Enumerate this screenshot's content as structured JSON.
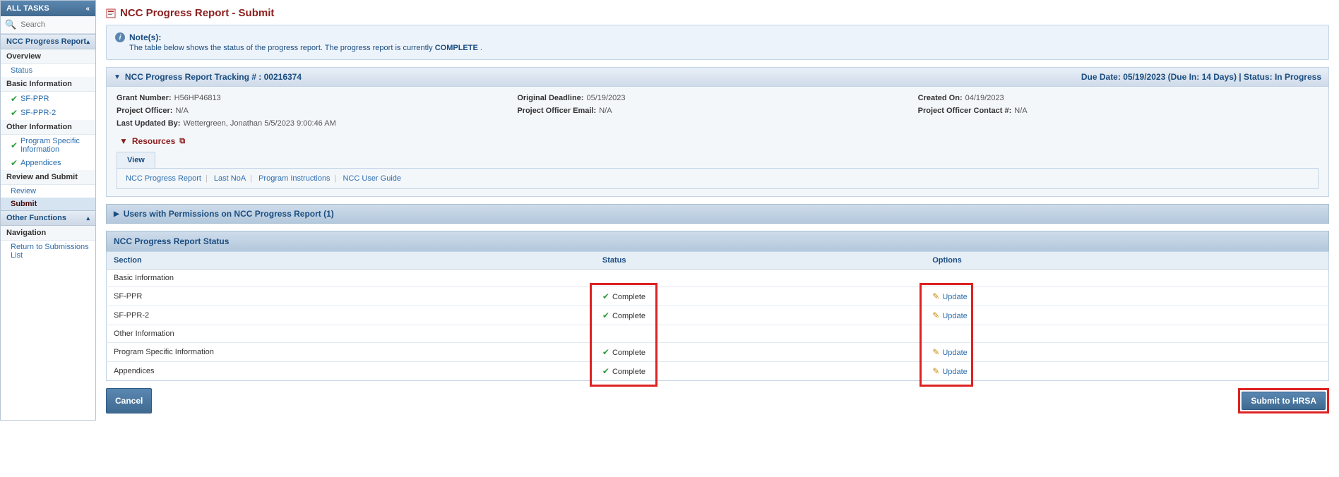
{
  "sidebar": {
    "header": "ALL TASKS",
    "search_placeholder": "Search",
    "group1": {
      "title": "NCC Progress Report"
    },
    "overview": {
      "title": "Overview",
      "items": [
        {
          "label": "Status"
        }
      ]
    },
    "basic": {
      "title": "Basic Information",
      "items": [
        {
          "label": "SF-PPR"
        },
        {
          "label": "SF-PPR-2"
        }
      ]
    },
    "other": {
      "title": "Other Information",
      "items": [
        {
          "label": "Program Specific Information"
        },
        {
          "label": "Appendices"
        }
      ]
    },
    "review": {
      "title": "Review and Submit",
      "items": [
        {
          "label": "Review"
        },
        {
          "label": "Submit"
        }
      ]
    },
    "otherfn": {
      "title": "Other Functions"
    },
    "navigation": {
      "title": "Navigation",
      "items": [
        {
          "label": "Return to Submissions List"
        }
      ]
    }
  },
  "page": {
    "title": "NCC Progress Report - Submit"
  },
  "notes": {
    "heading": "Note(s):",
    "body_prefix": "The table below shows the status of the progress report. The progress report is currently ",
    "body_strong": "COMPLETE",
    "body_suffix": " ."
  },
  "tracking": {
    "title": "NCC Progress Report Tracking # : 00216374",
    "right": "Due Date: 05/19/2023 (Due In: 14 Days) | Status: In Progress",
    "grant_k": "Grant Number:",
    "grant_v": "H56HP46813",
    "proj_officer_k": "Project Officer:",
    "proj_officer_v": "N/A",
    "updated_k": "Last Updated By:",
    "updated_v": "Wettergreen, Jonathan 5/5/2023 9:00:46 AM",
    "orig_deadline_k": "Original Deadline:",
    "orig_deadline_v": "05/19/2023",
    "po_email_k": "Project Officer Email:",
    "po_email_v": "N/A",
    "created_k": "Created On:",
    "created_v": "04/19/2023",
    "po_contact_k": "Project Officer Contact #:",
    "po_contact_v": "N/A"
  },
  "resources": {
    "title": "Resources",
    "tab": "View",
    "links": [
      "NCC Progress Report",
      "Last NoA",
      "Program Instructions",
      "NCC User Guide"
    ]
  },
  "perms": {
    "title": "Users with Permissions on NCC Progress Report (1)"
  },
  "status_table": {
    "title": "NCC Progress Report Status",
    "headers": {
      "section": "Section",
      "status": "Status",
      "options": "Options"
    },
    "rows": [
      {
        "section": "Basic Information",
        "status": "",
        "options": "",
        "group": true
      },
      {
        "section": "SF-PPR",
        "status": "Complete",
        "options": "Update"
      },
      {
        "section": "SF-PPR-2",
        "status": "Complete",
        "options": "Update"
      },
      {
        "section": "Other Information",
        "status": "",
        "options": "",
        "group": true
      },
      {
        "section": "Program Specific Information",
        "status": "Complete",
        "options": "Update"
      },
      {
        "section": "Appendices",
        "status": "Complete",
        "options": "Update"
      }
    ]
  },
  "buttons": {
    "cancel": "Cancel",
    "submit": "Submit to HRSA"
  }
}
